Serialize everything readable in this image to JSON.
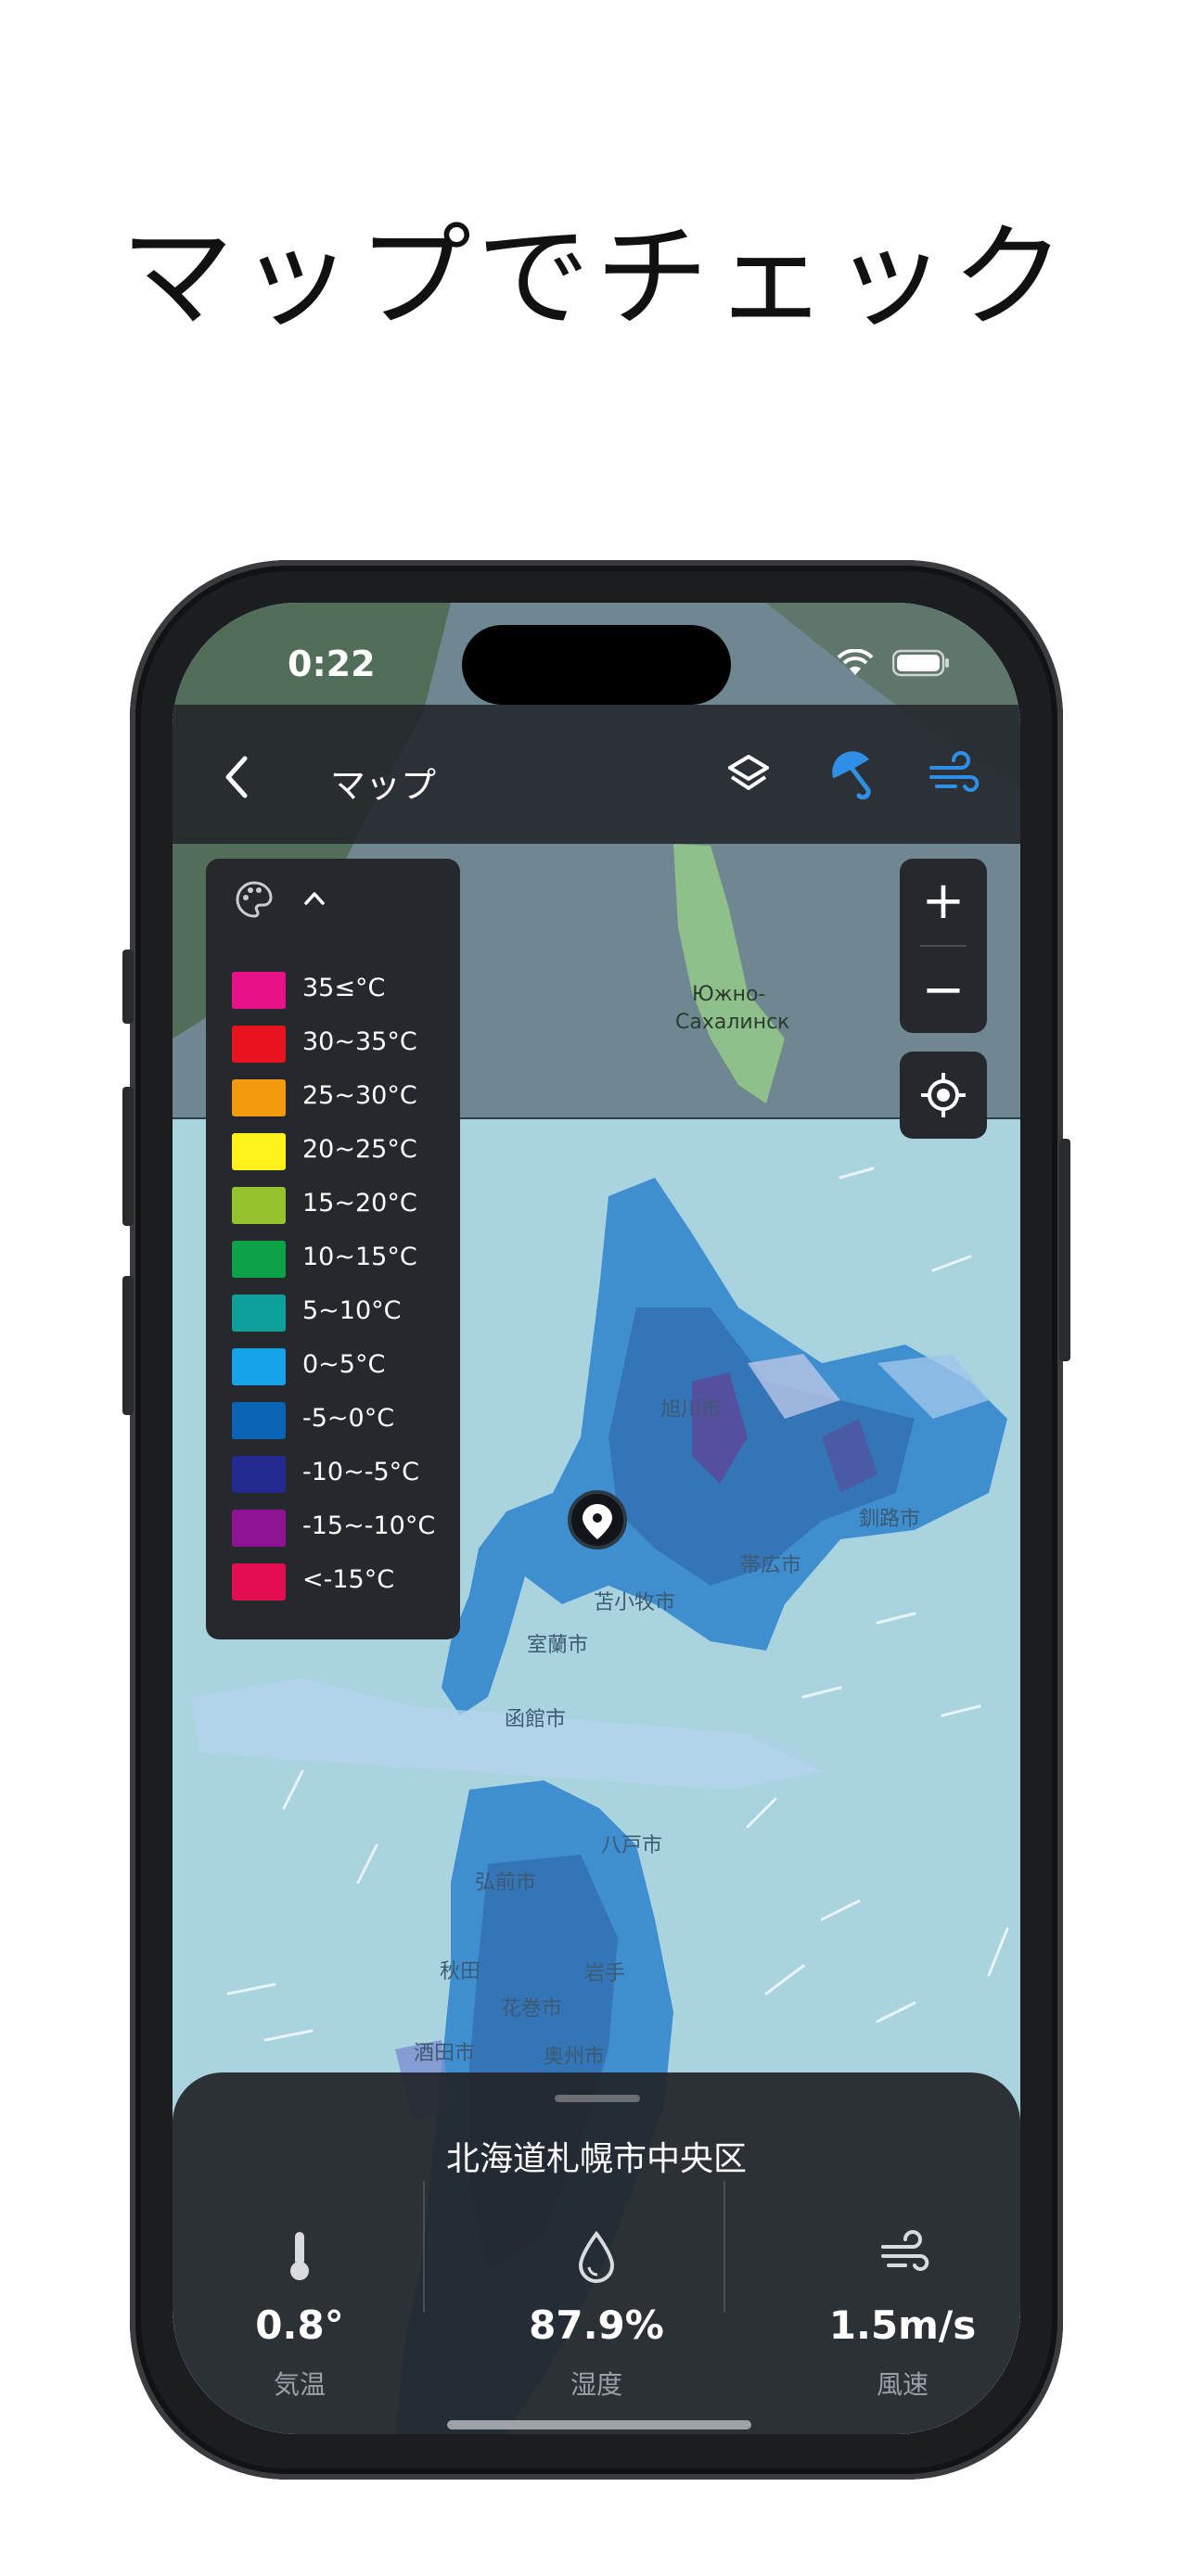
{
  "headline": "マップでチェック",
  "status_bar": {
    "time": "0:22"
  },
  "nav": {
    "title": "マップ"
  },
  "legend": {
    "items": [
      {
        "label": "35≤°C",
        "color": "#e8118a"
      },
      {
        "label": "30~35°C",
        "color": "#e8131f"
      },
      {
        "label": "25~30°C",
        "color": "#f39a0e"
      },
      {
        "label": "20~25°C",
        "color": "#fff21a"
      },
      {
        "label": "15~20°C",
        "color": "#96c22c"
      },
      {
        "label": "10~15°C",
        "color": "#0da14a"
      },
      {
        "label": "5~10°C",
        "color": "#0ea19b"
      },
      {
        "label": "0~5°C",
        "color": "#16a3e9"
      },
      {
        "label": "-5~0°C",
        "color": "#0b63b5"
      },
      {
        "label": "-10~-5°C",
        "color": "#232a8f"
      },
      {
        "label": "-15~-10°C",
        "color": "#8f1494"
      },
      {
        "label": "<-15°C",
        "color": "#e40d52"
      }
    ]
  },
  "zoom": {
    "in": "+",
    "out": "−"
  },
  "map_labels": {
    "yuzhno": "Южно-",
    "sakhalinsk": "Сахалинск",
    "asahikawa": "旭川市",
    "kushiro": "釧路市",
    "obihiro": "帯広市",
    "tomakomai": "苫小牧市",
    "muroran": "室蘭市",
    "hakodate": "函館市",
    "hachinohe": "八戸市",
    "hirosaki": "弘前市",
    "akita": "秋田",
    "iwate": "岩手",
    "hanamaki": "花巻市",
    "oshu": "奥州市",
    "sakata": "酒田市"
  },
  "bottom_sheet": {
    "place": "北海道札幌市中央区",
    "temperature": {
      "value": "0.8°",
      "label": "気温"
    },
    "humidity": {
      "value": "87.9%",
      "label": "湿度"
    },
    "wind": {
      "value": "1.5m/s",
      "label": "風速"
    }
  },
  "colors": {
    "accent": "#2f8fe6",
    "panel": "#25282c",
    "sea": "#a8d3de"
  }
}
